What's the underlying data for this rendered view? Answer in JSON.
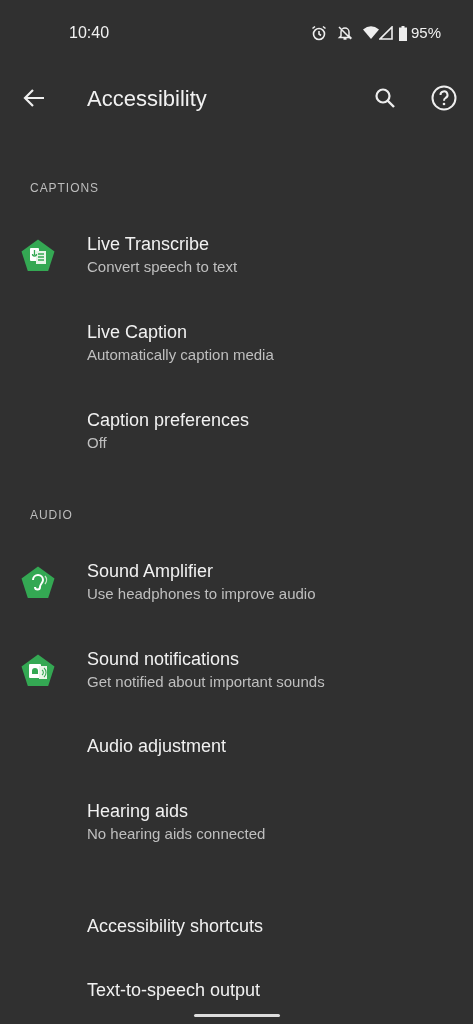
{
  "status_bar": {
    "time": "10:40",
    "battery": "95%"
  },
  "toolbar": {
    "title": "Accessibility"
  },
  "sections": [
    {
      "header": "CAPTIONS",
      "items": [
        {
          "title": "Live Transcribe",
          "subtitle": "Convert speech to text",
          "kind": "transcribe"
        },
        {
          "title": "Live Caption",
          "subtitle": "Automatically caption media"
        },
        {
          "title": "Caption preferences",
          "subtitle": "Off"
        }
      ]
    },
    {
      "header": "AUDIO",
      "items": [
        {
          "title": "Sound Amplifier",
          "subtitle": "Use headphones to improve audio",
          "kind": "ear"
        },
        {
          "title": "Sound notifications",
          "subtitle": "Get notified about important sounds",
          "kind": "bell"
        },
        {
          "title": "Audio adjustment"
        },
        {
          "title": "Hearing aids",
          "subtitle": "No hearing aids connected"
        }
      ]
    },
    {
      "items": [
        {
          "title": "Accessibility shortcuts"
        },
        {
          "title": "Text-to-speech output"
        }
      ]
    }
  ]
}
